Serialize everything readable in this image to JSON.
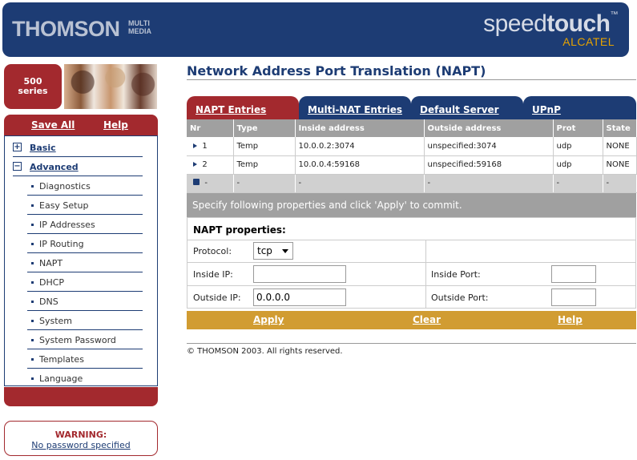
{
  "header": {
    "brand_left": "THOMSON",
    "brand_left_sub": "MULTI MEDIA",
    "brand_right_a": "speed",
    "brand_right_b": "touch",
    "brand_right_tm": "™",
    "brand_right_sub": "ALCATEL"
  },
  "sidebar": {
    "series_line1": "500",
    "series_line2": "series",
    "save_all": "Save All",
    "help": "Help",
    "sections": [
      {
        "label": "Basic",
        "icon": "plus"
      },
      {
        "label": "Advanced",
        "icon": "minus"
      }
    ],
    "items": [
      "Diagnostics",
      "Easy Setup",
      "IP Addresses",
      "IP Routing",
      "NAPT",
      "DHCP",
      "DNS",
      "System",
      "System Password",
      "Templates",
      "Language"
    ],
    "warning_title": "WARNING:",
    "warning_link": "No password specified"
  },
  "main": {
    "title": "Network Address Port Translation (NAPT)",
    "tabs": [
      "NAPT Entries",
      "Multi-NAT Entries",
      "Default Server",
      "UPnP"
    ],
    "table": {
      "headers": [
        "Nr",
        "Type",
        "Inside address",
        "Outside address",
        "Prot",
        "State"
      ],
      "rows": [
        [
          "1",
          "Temp",
          "10.0.0.2:3074",
          "unspecified:3074",
          "udp",
          "NONE"
        ],
        [
          "2",
          "Temp",
          "10.0.0.4:59168",
          "unspecified:59168",
          "udp",
          "NONE"
        ]
      ],
      "empty_row": [
        "-",
        "-",
        "-",
        "-",
        "-",
        "-"
      ]
    },
    "hint": "Specify following properties and click 'Apply' to commit.",
    "props": {
      "title": "NAPT properties:",
      "protocol_label": "Protocol:",
      "protocol_value": "tcp",
      "inside_ip_label": "Inside IP:",
      "inside_ip_value": "",
      "inside_port_label": "Inside Port:",
      "inside_port_value": "",
      "outside_ip_label": "Outside IP:",
      "outside_ip_value": "0.0.0.0",
      "outside_port_label": "Outside Port:",
      "outside_port_value": ""
    },
    "actions": {
      "apply": "Apply",
      "clear": "Clear",
      "help": "Help"
    },
    "footer": "© THOMSON 2003. All rights reserved."
  },
  "colors": {
    "navy": "#1d3c74",
    "red": "#a3292e",
    "gold": "#d19c32",
    "grey": "#a0a0a0"
  }
}
